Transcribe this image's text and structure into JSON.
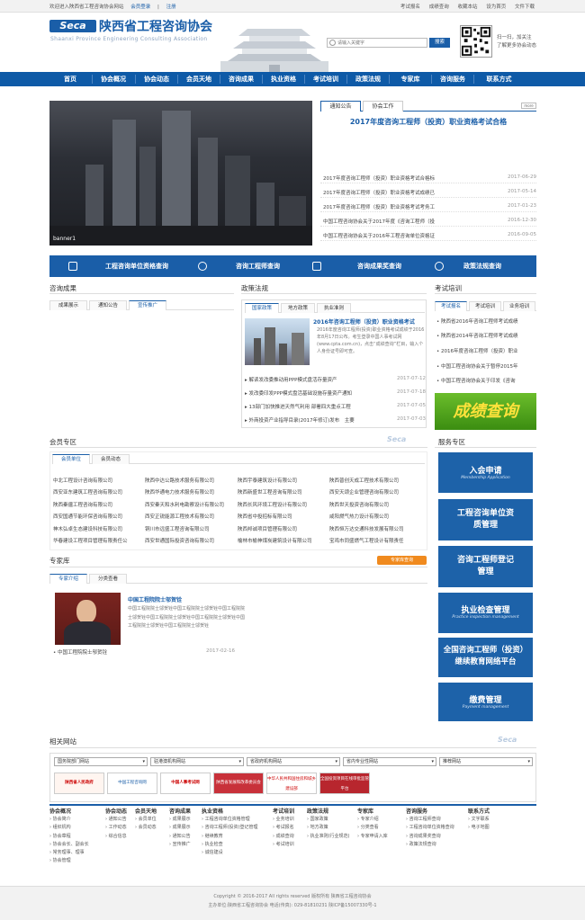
{
  "topbar": {
    "welcome": "欢迎进入陕西省工程咨询协会网站",
    "member_login": "会员登录",
    "register": "注册",
    "links": [
      "考试报名",
      "成绩查询",
      "收藏本站",
      "设为首页",
      "文件下载"
    ]
  },
  "header": {
    "logo_mark": "Seca",
    "org_name": "陕西省工程咨询协会",
    "org_name_en": "Shaanxi Province Engineering Consulting Association",
    "search_placeholder": "请输入关键字",
    "search_button": "搜索",
    "qr_text": [
      "扫一扫，加关注",
      "了解更多协会动态"
    ]
  },
  "nav": [
    "首页",
    "协会概况",
    "协会动态",
    "会员天地",
    "咨询成果",
    "执业资格",
    "考试培训",
    "政策法规",
    "专家库",
    "咨询服务",
    "联系方式"
  ],
  "banner": {
    "label": "banner1"
  },
  "notice": {
    "tabs": [
      "通知公告",
      "协会工作"
    ],
    "more": "more",
    "headline": "2017年度咨询工程师（投资）职业资格考试合格",
    "items": [
      {
        "t": "2017年度咨询工程师（投资）职业资格考试合格标",
        "d": "2017-06-29"
      },
      {
        "t": "2017年度咨询工程师（投资）职业资格考试成绩已",
        "d": "2017-05-14"
      },
      {
        "t": "2017年度咨询工程师（投资）职业资格考试考务工",
        "d": "2017-01-23"
      },
      {
        "t": "中国工程咨询协会关于2017年度《咨询工程师（投",
        "d": "2016-12-30"
      },
      {
        "t": "中国工程咨询协会关于2016年工程咨询单位资格证",
        "d": "2016-09-05"
      }
    ]
  },
  "strip": [
    "工程咨询单位资格查询",
    "咨询工程师查询",
    "咨询成果奖查询",
    "政策法规查询"
  ],
  "consult": {
    "title": "咨询成果",
    "tabs": [
      "成果展示",
      "通知公告",
      "宣传推广"
    ]
  },
  "policy": {
    "title": "政策法规",
    "tabs": [
      "国家政策",
      "地方政策",
      "执业准则"
    ],
    "headline": "2016年咨询工程师（投资）职业资格考试",
    "summary": "2016年度咨询工程师(投资)职业资格考试成绩于2016年8月17日公布。考生登录中国人事考试网(www.cpta.com.cn)，点击“成绩查询”栏目，输入个人身份证号即可查。",
    "items": [
      {
        "t": "解读发改委推动用PPP模式盘活存量资产",
        "d": "2017-07-12"
      },
      {
        "t": "发改委印发PPP模式盘活基础设施存量资产通知",
        "d": "2017-07-18"
      },
      {
        "t": "13部门加快推进天然气利用 部署四大重点工程",
        "d": "2017-07-05"
      },
      {
        "t": "外商投资产业指导目录(2017年修订)发布　主要",
        "d": "2017-07-03"
      }
    ]
  },
  "exam": {
    "title": "考试培训",
    "tabs": [
      "考试报名",
      "考试培训",
      "业务培训"
    ],
    "items": [
      "陕西省2016年咨询工程师考试成绩",
      "陕西省2014年咨询工程师考试成绩",
      "2016年度咨询工程师（投资）职业",
      "中国工程咨询协会关于暂停2015年",
      "中国工程咨询协会关于印发《咨询"
    ],
    "banner_text": "成绩查询"
  },
  "member": {
    "title": "会员专区",
    "tabs": [
      "会员单位",
      "会员动态"
    ],
    "rows": [
      [
        "中北工程设计咨询有限公司",
        "陕西中达公路技术服务有限公司",
        "陕西宇泰建筑设计有限公司",
        "陕西普创天成工程技术有限公司"
      ],
      [
        "西安亚东建筑工程咨询有限公司",
        "陕西华通电力技术服务有限公司",
        "陕西新盛世工程咨询有限公司",
        "西安天颂企业管理咨询有限公司"
      ],
      [
        "陕西秦疆工程咨询有限公司",
        "西安秦天和水利电勘察设计有限公司",
        "陕西长风环境工程设计有限公司",
        "陕西世天投资咨询有限公司"
      ],
      [
        "西安国通节能环保咨询有限公司",
        "西安正锐能源工程技术有限公司",
        "陕西省中投招标有限公司",
        "咸阳燃气热力设计有限公司"
      ],
      [
        "神木弘卓生态建设科技有限公司",
        "铜川市远盛工程咨询有限公司",
        "陕西邦诚项目管理有限公司",
        "陕西恒万达交通科技发展有限公司"
      ],
      [
        "华春建设工程项目管理有限责任公",
        "西安世通国际投资咨询有限公司",
        "榆林市榆神煤炭建筑设计有限公司",
        "宝鸡市同盛燃气工程设计有限责任"
      ]
    ]
  },
  "service": {
    "title": "服务专区",
    "items": [
      {
        "cn": "入会申请",
        "en": "Membership Application"
      },
      {
        "cn": "工程咨询单位资质管理",
        "en": ""
      },
      {
        "cn": "咨询工程师登记管理",
        "en": ""
      },
      {
        "cn": "执业检查管理",
        "en": "Practice inspection management"
      },
      {
        "cn": "全国咨询工程师（投资）继续教育网络平台",
        "en": ""
      },
      {
        "cn": "缴费管理",
        "en": "Payment management"
      }
    ]
  },
  "expert": {
    "title": "专家库",
    "button": "专家库查询",
    "tabs": [
      "专家介绍",
      "分类查看"
    ],
    "name": "中国工程院院士邬贺铨",
    "desc": "中国工程院院士邬贺铨中国工程院院士邬贺铨中国工程院院士邬贺铨中国工程院院士邬贺铨中国工程院院士邬贺铨中国工程院院士邬贺铨中国工程院院士邬贺铨",
    "item": {
      "t": "中国工程院院士邬贺铨",
      "d": "2017-02-16"
    }
  },
  "related": {
    "title": "相关网站",
    "selects": [
      "国务院部门网站",
      "驻港澳机构网站",
      "省政府机构网站",
      "省内专业性网站",
      "推荐网站"
    ],
    "logos": [
      "陕西省人民政府",
      "中国工程咨询网",
      "中国人事考试网",
      "陕西省发展和改革委员会",
      "中华人民共和国住房和城乡建设部",
      "全国投资项目在线审批监管平台"
    ]
  },
  "footer": {
    "cols": [
      {
        "h": "协会概况",
        "items": [
          "协会简介",
          "组织机构",
          "协会章程",
          "协会会长、副会长",
          "常务理事、理事",
          "协会管理"
        ]
      },
      {
        "h": "协会动态",
        "items": [
          "通知公告",
          "工作动态",
          "综合信息"
        ]
      },
      {
        "h": "会员天地",
        "items": [
          "会员单位",
          "会员动态"
        ]
      },
      {
        "h": "咨询成果",
        "items": [
          "成果展示",
          "成果展示",
          "通知公告",
          "宣传推广"
        ]
      },
      {
        "h": "执业资格",
        "items": [
          "工程咨询单位资格管理",
          "咨询工程师(投资)登记管理",
          "继续教育",
          "执业检查",
          "诚信建设"
        ]
      },
      {
        "h": "考试培训",
        "items": [
          "业务培训",
          "考试报名",
          "成绩查询",
          "考试培训"
        ]
      },
      {
        "h": "政策法规",
        "items": [
          "国家政策",
          "地方政策",
          "执业准则(行业规范)"
        ]
      },
      {
        "h": "专家库",
        "items": [
          "专家介绍",
          "分类查看",
          "专家申请入库"
        ]
      },
      {
        "h": "咨询服务",
        "items": [
          "咨询工程师查询",
          "工程咨询单位资格查询",
          "咨询成果奖查询",
          "政策法规查询"
        ]
      },
      {
        "h": "联系方式",
        "items": [
          "文字联系",
          "电子地图"
        ]
      }
    ],
    "copyright": "Copyright © 2016-2017 All rights reserved 版权所有 陕西省工程咨询协会",
    "address": "主办单位:陕西省工程咨询协会  电话(传真): 029-81810231  陕ICP备15007330号-1"
  },
  "colors": {
    "primary": "#1a5ea8",
    "nav": "#0e5aa7",
    "accent_orange": "#f08a1e",
    "green": "#4a9e1a"
  }
}
